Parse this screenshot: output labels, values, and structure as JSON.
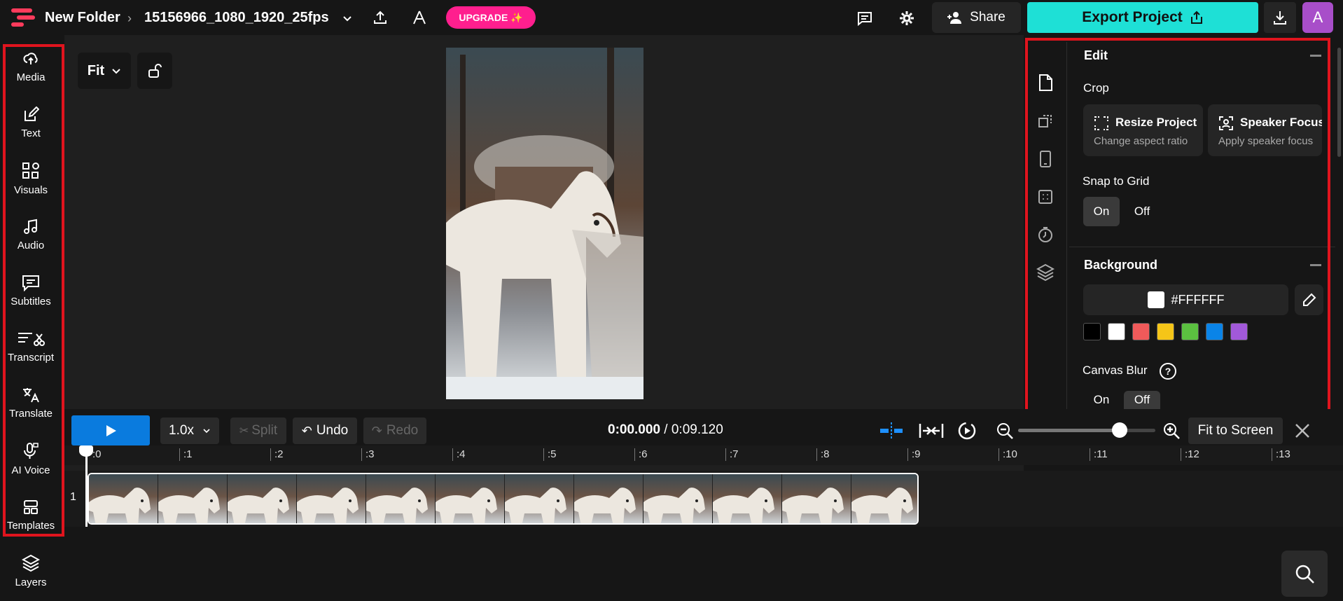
{
  "topbar": {
    "folder": "New Folder",
    "filename": "15156966_1080_1920_25fps",
    "upgrade_label": "UPGRADE ✨",
    "share_label": "Share",
    "export_label": "Export Project",
    "avatar_initial": "A"
  },
  "sidebar": {
    "items": [
      {
        "label": "Media",
        "icon": "upload-cloud-icon"
      },
      {
        "label": "Text",
        "icon": "edit-text-icon"
      },
      {
        "label": "Visuals",
        "icon": "shapes-icon"
      },
      {
        "label": "Audio",
        "icon": "music-note-icon"
      },
      {
        "label": "Subtitles",
        "icon": "subtitles-icon"
      },
      {
        "label": "Transcript",
        "icon": "transcript-icon"
      },
      {
        "label": "Translate",
        "icon": "translate-icon"
      },
      {
        "label": "AI Voice",
        "icon": "microphone-icon"
      },
      {
        "label": "Templates",
        "icon": "templates-icon"
      },
      {
        "label": "Layers",
        "icon": "layers-icon"
      }
    ]
  },
  "canvas": {
    "fit_label": "Fit"
  },
  "right_panel": {
    "edit_title": "Edit",
    "crop_label": "Crop",
    "resize_title": "Resize Project",
    "resize_sub": "Change aspect ratio",
    "speaker_title": "Speaker Focus",
    "speaker_sub": "Apply speaker focus",
    "snap_label": "Snap to Grid",
    "on_label": "On",
    "off_label": "Off",
    "background_title": "Background",
    "bg_hex": "#FFFFFF",
    "swatches": [
      "#000000",
      "#ffffff",
      "#f05a5a",
      "#f5c518",
      "#5bc040",
      "#0a84e8",
      "#a259d9"
    ],
    "canvas_blur_label": "Canvas Blur",
    "blur_on": "On",
    "blur_off": "Off"
  },
  "timeline": {
    "speed": "1.0x",
    "split_label": "Split",
    "undo_label": "Undo",
    "redo_label": "Redo",
    "current_time": "0:00.000",
    "total_time": "/ 0:09.120",
    "fit_screen_label": "Fit to Screen",
    "track_number": "1",
    "zoom_level": 0.74,
    "ruler": [
      ":0",
      ":1",
      ":2",
      ":3",
      ":4",
      ":5",
      ":6",
      ":7",
      ":8",
      ":9",
      ":10",
      ":11",
      ":12",
      ":13"
    ]
  },
  "colors": {
    "accent_teal": "#1ee0d6",
    "play_blue": "#0a7bde",
    "upgrade_pink": "#ff1f8e",
    "avatar_purple": "#a84ec9",
    "highlight_red": "#e0141e"
  }
}
